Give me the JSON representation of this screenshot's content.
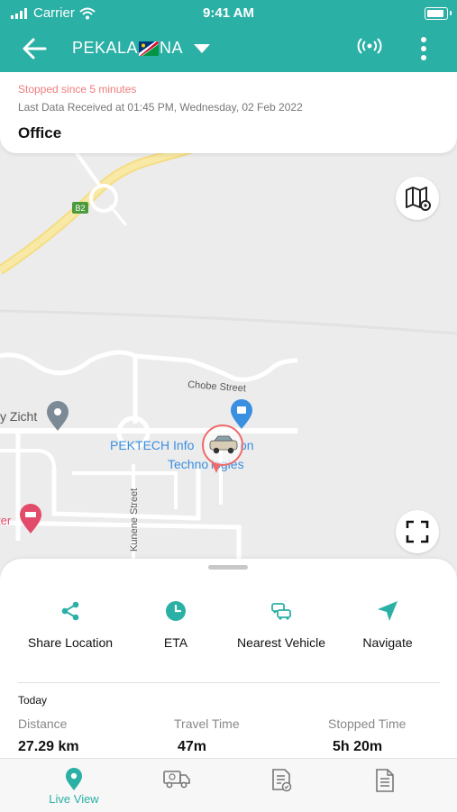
{
  "status_bar": {
    "carrier": "Carrier",
    "time": "9:41 AM"
  },
  "app_bar": {
    "title_prefix": "PEKALA",
    "title_suffix": "NA"
  },
  "info_card": {
    "status": "Stopped since 5 minutes",
    "last_data": "Last Data Received at 01:45 PM, Wednesday, 02 Feb 2022",
    "location": "Office"
  },
  "map": {
    "road_badge": "B2",
    "street_chobe": "Chobe Street",
    "street_kunene": "Kunene Street",
    "poi_name_line1": "PEKTECH Info",
    "poi_name_line1_end": "on",
    "poi_name_line2": "Techno",
    "poi_name_line2_end": "logies",
    "poi_left": "y Zicht",
    "poi_left2": "ter"
  },
  "actions": [
    {
      "label": "Share Location",
      "icon": "share-icon"
    },
    {
      "label": "ETA",
      "icon": "clock-icon"
    },
    {
      "label": "Nearest Vehicle",
      "icon": "nearest-vehicle-icon"
    },
    {
      "label": "Navigate",
      "icon": "navigate-icon"
    }
  ],
  "stats": {
    "period": "Today",
    "distance_label": "Distance",
    "distance_value": "27.29 km",
    "travel_label": "Travel Time",
    "travel_value": "47m",
    "stopped_label": "Stopped Time",
    "stopped_value": "5h 20m"
  },
  "bottom_nav": {
    "live_view": "Live View"
  },
  "colors": {
    "primary": "#2bb0a6",
    "alert": "#f07c7c",
    "poi_blue": "#3a8fe0"
  }
}
